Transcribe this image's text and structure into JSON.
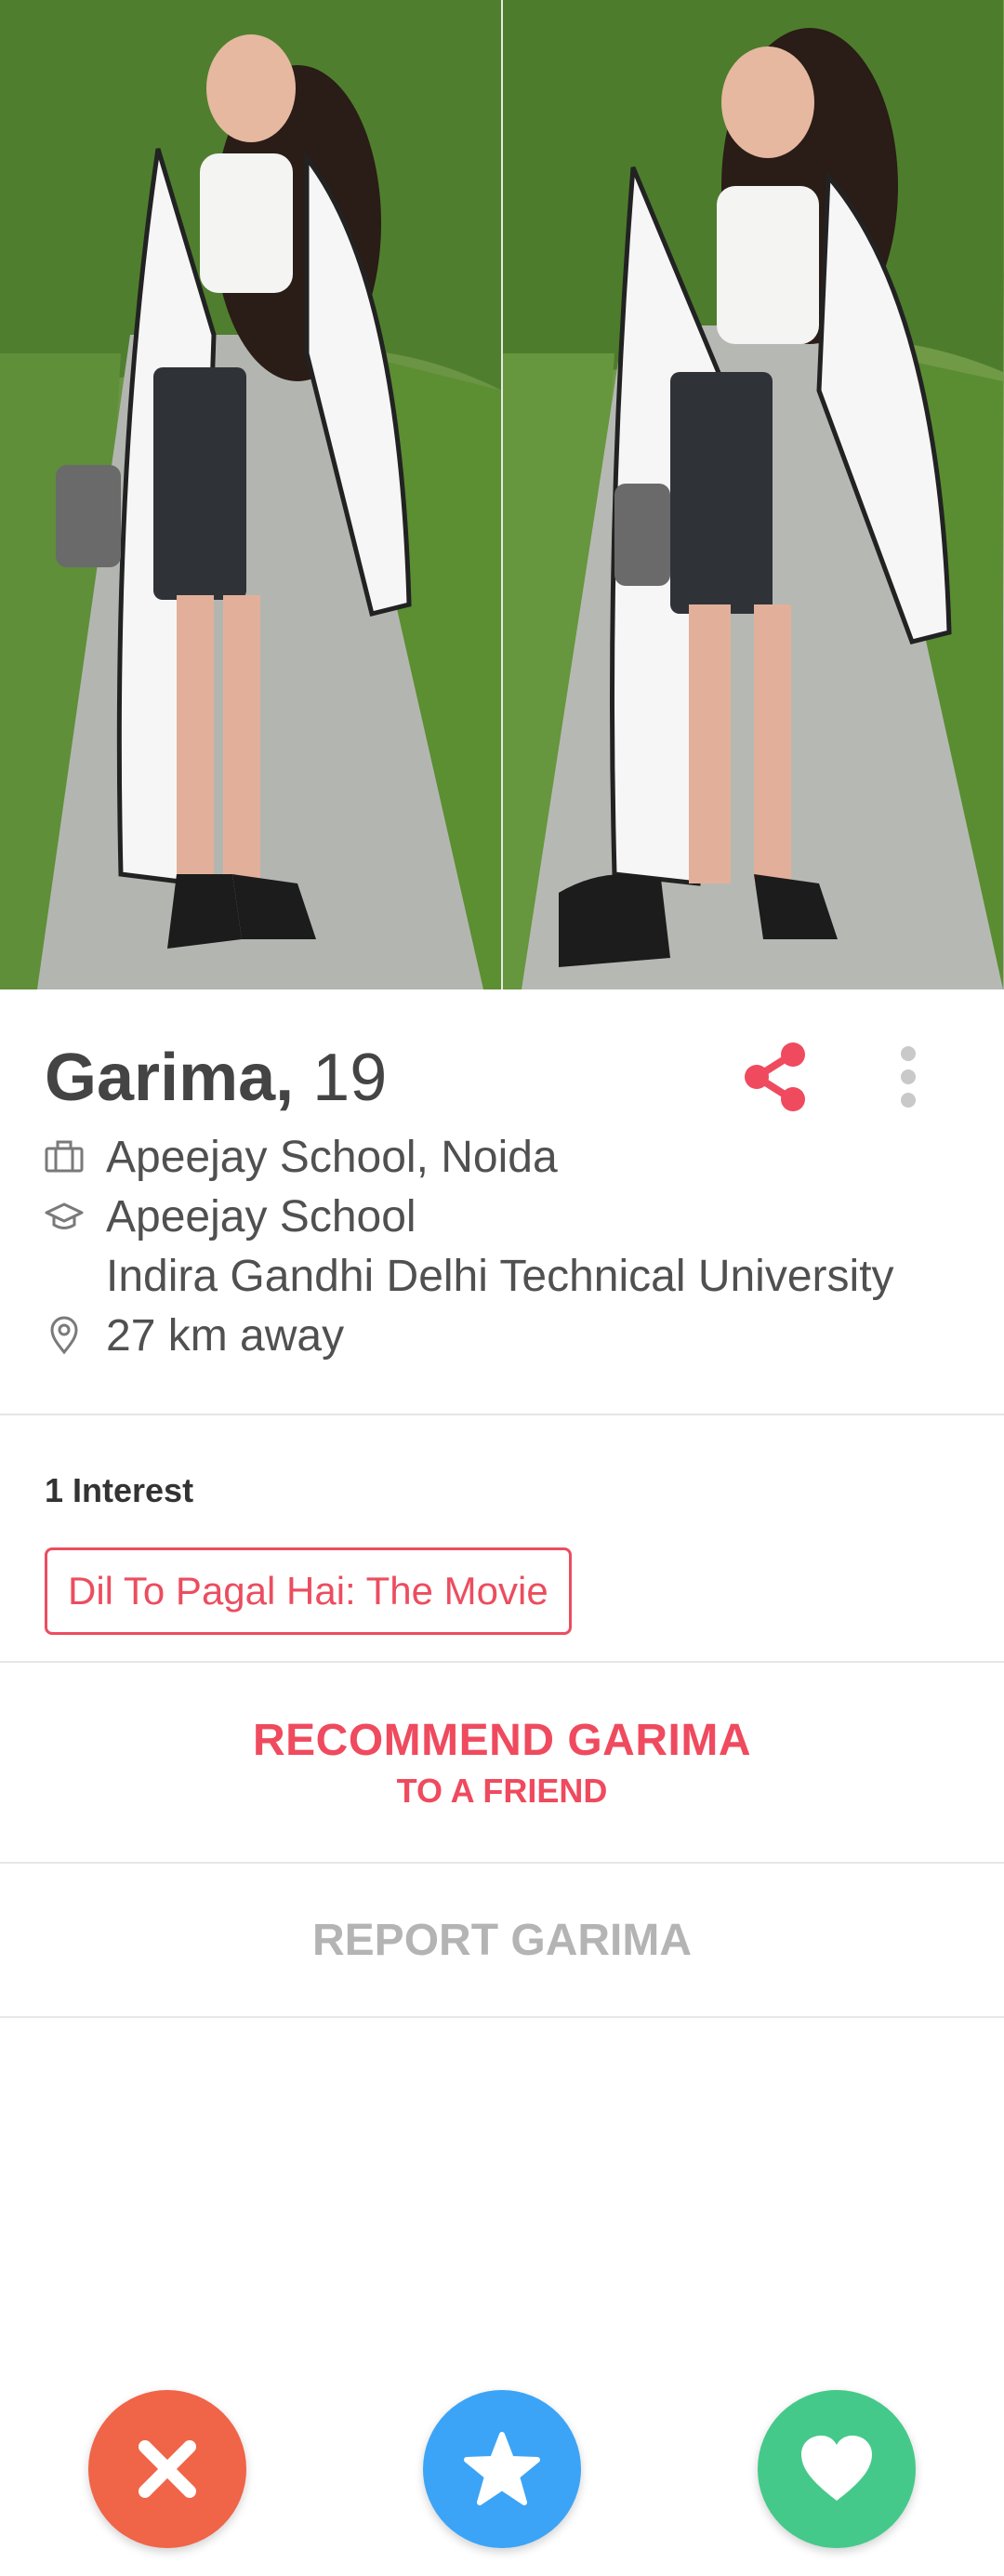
{
  "profile": {
    "name": "Garima,",
    "age": "19",
    "job": "Apeejay School, Noida",
    "school_1": "Apeejay School",
    "school_2": "Indira Gandhi Delhi Technical University",
    "distance": "27 km away"
  },
  "interests": {
    "title": "1 Interest",
    "items": [
      "Dil To Pagal Hai: The Movie"
    ]
  },
  "recommend": {
    "main": "RECOMMEND GARIMA",
    "sub": "TO A FRIEND"
  },
  "report": {
    "label": "REPORT GARIMA"
  },
  "icons": {
    "share": "share-icon",
    "more": "more-vertical-icon",
    "job": "briefcase-icon",
    "school": "graduation-cap-icon",
    "location": "location-pin-icon",
    "nope": "close-icon",
    "superlike": "star-icon",
    "like": "heart-icon"
  },
  "colors": {
    "accent": "#ec4d5f",
    "nope": "#f06448",
    "superlike": "#3ca4f6",
    "like": "#45c98a",
    "text": "#505050",
    "muted": "#b4b4b4"
  }
}
